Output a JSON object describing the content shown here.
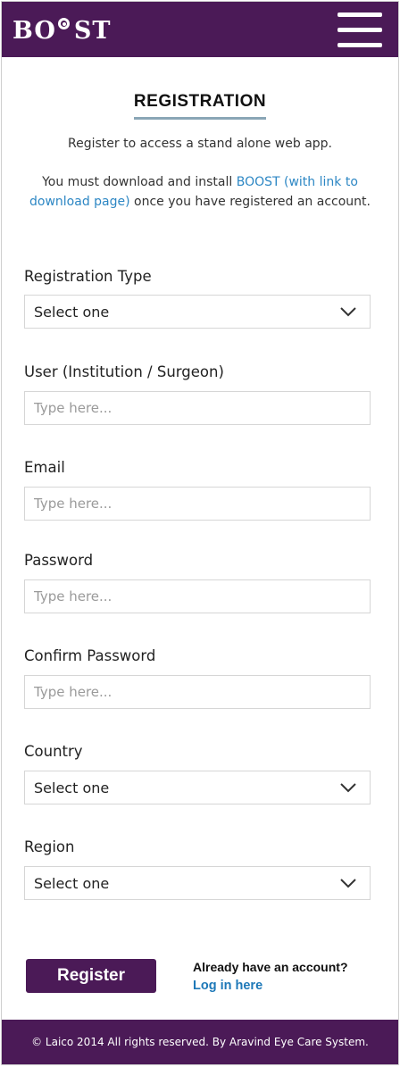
{
  "header": {
    "logo_left": "BO",
    "logo_right": "ST",
    "menu_icon": "hamburger-menu-icon",
    "bg_color": "#4b1a57"
  },
  "page": {
    "title": "REGISTRATION",
    "intro_line": "Register to access a stand alone web app.",
    "download_prefix": "You must download and install ",
    "download_link": "BOOST (with link to download page)",
    "download_suffix": " once you have registered an account."
  },
  "form": {
    "registration_type": {
      "label": "Registration Type",
      "value": "Select one"
    },
    "user": {
      "label": "User (Institution / Surgeon)",
      "placeholder": "Type here..."
    },
    "email": {
      "label": "Email",
      "placeholder": "Type here..."
    },
    "password": {
      "label": "Password",
      "placeholder": "Type here..."
    },
    "confirm_password": {
      "label": "Confirm Password",
      "placeholder": "Type here..."
    },
    "country": {
      "label": "Country",
      "value": "Select one"
    },
    "region": {
      "label": "Region",
      "value": "Select one"
    }
  },
  "actions": {
    "register_label": "Register",
    "account_question": "Already have an account?",
    "login_label": "Log in here"
  },
  "footer": {
    "text": "© Laico 2014 All rights reserved. By Aravind Eye Care System."
  },
  "colors": {
    "brand": "#4b1a57",
    "link": "#2d87c4",
    "title_underline": "#8aa6b6"
  }
}
